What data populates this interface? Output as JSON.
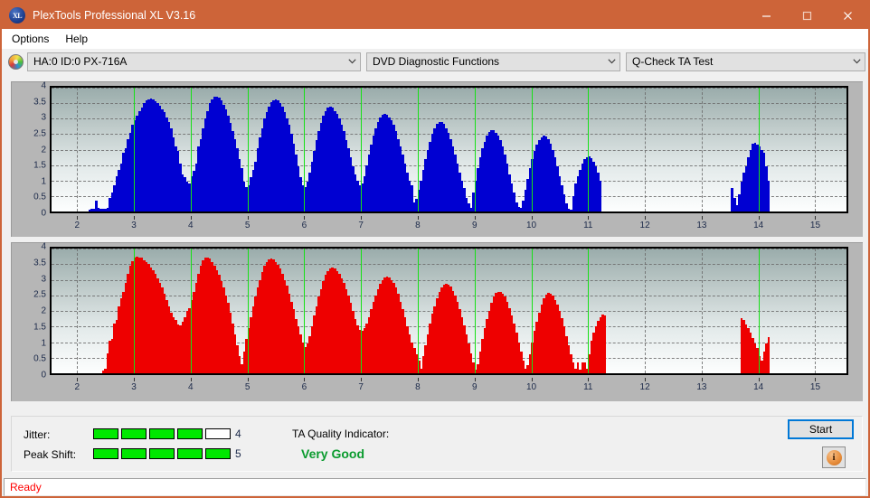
{
  "window": {
    "title": "PlexTools Professional XL V3.16",
    "app_icon": "xl-logo-icon",
    "minimize": "minimize-icon",
    "maximize": "maximize-icon",
    "close": "close-icon",
    "titlebar_color": "#cd6439"
  },
  "menu": {
    "items": [
      {
        "label": "Options"
      },
      {
        "label": "Help"
      }
    ]
  },
  "toolbar": {
    "drive_icon": "disc-icon",
    "drive_select": {
      "value": "HA:0 ID:0  PX-716A"
    },
    "function_select": {
      "value": "DVD Diagnostic Functions"
    },
    "test_select": {
      "value": "Q-Check TA Test"
    }
  },
  "results": {
    "jitter_label": "Jitter:",
    "jitter_value": "4",
    "jitter_segments": 5,
    "jitter_filled": 4,
    "peak_shift_label": "Peak Shift:",
    "peak_shift_value": "5",
    "peak_shift_segments": 5,
    "peak_shift_filled": 5,
    "ta_title": "TA Quality Indicator:",
    "ta_value": "Very Good",
    "ta_color": "#0a9b2e",
    "start_label": "Start",
    "info_icon": "info-icon",
    "info_glyph": "i"
  },
  "statusbar": {
    "text": "Ready"
  },
  "chart_data": [
    {
      "id": "ta-test-jitter",
      "type": "bar",
      "title": "",
      "xlabel": "",
      "ylabel": "",
      "color": "#0000d2",
      "bar_color": "#0000d2",
      "bg_top": "#9aacab",
      "bg_bottom": "#fdfefe",
      "xlim": [
        1.55,
        15.55
      ],
      "ylim": [
        0,
        4
      ],
      "yticks": [
        0,
        0.5,
        1,
        1.5,
        2,
        2.5,
        3,
        3.5,
        4
      ],
      "ytick_labels": [
        "0",
        "0.5",
        "1",
        "1.5",
        "2",
        "2.5",
        "3",
        "3.5",
        "4"
      ],
      "xticks": [
        2,
        3,
        4,
        5,
        6,
        7,
        8,
        9,
        10,
        11,
        12,
        13,
        14,
        15
      ],
      "xtick_labels": [
        "2",
        "3",
        "4",
        "5",
        "6",
        "7",
        "8",
        "9",
        "10",
        "11",
        "12",
        "13",
        "14",
        "15"
      ],
      "grid": true,
      "markers": [
        3,
        4,
        5,
        6,
        7,
        8,
        9,
        10,
        11,
        14
      ],
      "marker_color": "#17e017",
      "bar_width_x": 0.042,
      "x": [
        2.22,
        2.26,
        2.3,
        2.34,
        2.38,
        2.42,
        2.46,
        2.5,
        2.54,
        2.58,
        2.62,
        2.66,
        2.7,
        2.74,
        2.78,
        2.82,
        2.86,
        2.9,
        2.94,
        2.98,
        3.02,
        3.06,
        3.1,
        3.14,
        3.18,
        3.22,
        3.26,
        3.3,
        3.34,
        3.38,
        3.42,
        3.46,
        3.5,
        3.54,
        3.58,
        3.62,
        3.66,
        3.7,
        3.74,
        3.78,
        3.82,
        3.86,
        3.9,
        3.94,
        3.98,
        4.02,
        4.06,
        4.1,
        4.14,
        4.18,
        4.22,
        4.26,
        4.3,
        4.34,
        4.38,
        4.42,
        4.46,
        4.5,
        4.54,
        4.58,
        4.62,
        4.66,
        4.7,
        4.74,
        4.78,
        4.82,
        4.86,
        4.9,
        4.94,
        4.98,
        5.02,
        5.06,
        5.1,
        5.14,
        5.18,
        5.22,
        5.26,
        5.3,
        5.34,
        5.38,
        5.42,
        5.46,
        5.5,
        5.54,
        5.58,
        5.62,
        5.66,
        5.7,
        5.74,
        5.78,
        5.82,
        5.86,
        5.9,
        5.94,
        5.98,
        6.02,
        6.06,
        6.1,
        6.14,
        6.18,
        6.22,
        6.26,
        6.3,
        6.34,
        6.38,
        6.42,
        6.46,
        6.5,
        6.54,
        6.58,
        6.62,
        6.66,
        6.7,
        6.74,
        6.78,
        6.82,
        6.86,
        6.9,
        6.94,
        6.98,
        7.02,
        7.06,
        7.1,
        7.14,
        7.18,
        7.22,
        7.26,
        7.3,
        7.34,
        7.38,
        7.42,
        7.46,
        7.5,
        7.54,
        7.58,
        7.62,
        7.66,
        7.7,
        7.74,
        7.78,
        7.82,
        7.86,
        7.9,
        7.94,
        7.98,
        8.02,
        8.06,
        8.1,
        8.14,
        8.18,
        8.22,
        8.26,
        8.3,
        8.34,
        8.38,
        8.42,
        8.46,
        8.5,
        8.54,
        8.58,
        8.62,
        8.66,
        8.7,
        8.74,
        8.78,
        8.82,
        8.86,
        8.9,
        8.94,
        8.98,
        9.02,
        9.06,
        9.1,
        9.14,
        9.18,
        9.22,
        9.26,
        9.3,
        9.34,
        9.38,
        9.42,
        9.46,
        9.5,
        9.54,
        9.58,
        9.62,
        9.66,
        9.7,
        9.74,
        9.78,
        9.82,
        9.86,
        9.9,
        9.94,
        9.98,
        10.02,
        10.06,
        10.1,
        10.14,
        10.18,
        10.22,
        10.26,
        10.3,
        10.34,
        10.38,
        10.42,
        10.46,
        10.5,
        10.54,
        10.58,
        10.62,
        10.66,
        10.7,
        10.74,
        10.78,
        10.82,
        10.86,
        10.9,
        10.94,
        10.98,
        11.02,
        11.06,
        11.1,
        11.14,
        11.18,
        11.22,
        13.54,
        13.58,
        13.62,
        13.66,
        13.7,
        13.74,
        13.78,
        13.82,
        13.86,
        13.9,
        13.94,
        13.98,
        14.02,
        14.06,
        14.1,
        14.14,
        14.18
      ],
      "values": [
        0.05,
        0.08,
        0.1,
        0.36,
        0.12,
        0.1,
        0.1,
        0.1,
        0.12,
        0.45,
        0.62,
        0.85,
        1.15,
        1.35,
        1.55,
        1.9,
        2.05,
        2.35,
        2.55,
        2.8,
        2.95,
        3.1,
        3.25,
        3.35,
        3.5,
        3.58,
        3.62,
        3.65,
        3.62,
        3.55,
        3.5,
        3.42,
        3.3,
        3.2,
        3.05,
        2.9,
        2.7,
        2.4,
        2.1,
        1.95,
        1.55,
        1.2,
        1.1,
        0.95,
        0.9,
        1.15,
        1.3,
        1.55,
        2.1,
        2.35,
        2.7,
        3.0,
        3.25,
        3.5,
        3.62,
        3.7,
        3.72,
        3.68,
        3.6,
        3.45,
        3.3,
        3.1,
        2.85,
        2.6,
        2.35,
        2.05,
        1.7,
        1.4,
        0.95,
        0.8,
        0.85,
        1.1,
        1.35,
        1.6,
        2.05,
        2.4,
        2.7,
        3.0,
        3.2,
        3.4,
        3.52,
        3.6,
        3.63,
        3.6,
        3.5,
        3.4,
        3.2,
        3.0,
        2.8,
        2.5,
        2.2,
        1.85,
        1.45,
        1.1,
        0.85,
        0.8,
        0.95,
        1.25,
        1.6,
        1.95,
        2.3,
        2.6,
        2.85,
        3.1,
        3.25,
        3.35,
        3.38,
        3.35,
        3.25,
        3.15,
        3.0,
        2.8,
        2.6,
        2.3,
        2.05,
        1.75,
        1.45,
        1.2,
        1.0,
        0.85,
        0.9,
        1.15,
        1.5,
        1.85,
        2.15,
        2.45,
        2.7,
        2.9,
        3.05,
        3.12,
        3.15,
        3.12,
        3.05,
        2.95,
        2.8,
        2.6,
        2.35,
        2.1,
        1.85,
        1.55,
        1.25,
        1.0,
        0.85,
        0.3,
        0.4,
        0.7,
        1.0,
        1.35,
        1.7,
        2.0,
        2.25,
        2.5,
        2.7,
        2.82,
        2.88,
        2.88,
        2.82,
        2.7,
        2.55,
        2.35,
        2.1,
        1.85,
        1.55,
        1.25,
        1.0,
        0.75,
        0.45,
        0.25,
        0.12,
        0.6,
        1.0,
        1.4,
        1.75,
        2.05,
        2.25,
        2.45,
        2.58,
        2.62,
        2.62,
        2.55,
        2.45,
        2.3,
        2.1,
        1.85,
        1.55,
        1.2,
        0.9,
        0.6,
        0.3,
        0.15,
        0.12,
        0.35,
        0.7,
        1.05,
        1.4,
        1.7,
        1.95,
        2.15,
        2.3,
        2.4,
        2.45,
        2.42,
        2.35,
        2.2,
        2.0,
        1.75,
        1.45,
        1.15,
        0.85,
        0.55,
        0.25,
        0.1,
        0.05,
        0.5,
        0.9,
        1.15,
        1.35,
        1.55,
        1.68,
        1.75,
        1.78,
        1.72,
        1.62,
        1.45,
        1.25,
        1.0,
        0.75,
        0.45,
        0.2,
        0.55,
        0.95,
        1.25,
        1.45,
        1.75,
        2.0,
        2.18,
        2.22,
        2.15,
        2.1,
        2.0,
        1.9,
        1.45,
        1.0,
        0.6,
        0.25,
        0.1
      ]
    },
    {
      "id": "ta-test-peak-shift",
      "type": "bar",
      "title": "",
      "xlabel": "",
      "ylabel": "",
      "color": "#ee0000",
      "bar_color": "#ee0000",
      "bg_top": "#9aacab",
      "bg_bottom": "#fdfefe",
      "xlim": [
        1.55,
        15.55
      ],
      "ylim": [
        0,
        4
      ],
      "yticks": [
        0,
        0.5,
        1,
        1.5,
        2,
        2.5,
        3,
        3.5,
        4
      ],
      "ytick_labels": [
        "0",
        "0.5",
        "1",
        "1.5",
        "2",
        "2.5",
        "3",
        "3.5",
        "4"
      ],
      "xticks": [
        2,
        3,
        4,
        5,
        6,
        7,
        8,
        9,
        10,
        11,
        12,
        13,
        14,
        15
      ],
      "xtick_labels": [
        "2",
        "3",
        "4",
        "5",
        "6",
        "7",
        "8",
        "9",
        "10",
        "11",
        "12",
        "13",
        "14",
        "15"
      ],
      "grid": true,
      "markers": [
        3,
        4,
        5,
        6,
        7,
        8,
        9,
        10,
        11,
        14
      ],
      "marker_color": "#17e017",
      "bar_width_x": 0.042,
      "x": [
        2.46,
        2.5,
        2.54,
        2.58,
        2.62,
        2.66,
        2.7,
        2.74,
        2.78,
        2.82,
        2.86,
        2.9,
        2.94,
        2.98,
        3.02,
        3.06,
        3.1,
        3.14,
        3.18,
        3.22,
        3.26,
        3.3,
        3.34,
        3.38,
        3.42,
        3.46,
        3.5,
        3.54,
        3.58,
        3.62,
        3.66,
        3.7,
        3.74,
        3.78,
        3.82,
        3.86,
        3.9,
        3.94,
        3.98,
        4.02,
        4.06,
        4.1,
        4.14,
        4.18,
        4.22,
        4.26,
        4.3,
        4.34,
        4.38,
        4.42,
        4.46,
        4.5,
        4.54,
        4.58,
        4.62,
        4.66,
        4.7,
        4.74,
        4.78,
        4.82,
        4.86,
        4.9,
        4.94,
        4.98,
        5.02,
        5.06,
        5.1,
        5.14,
        5.18,
        5.22,
        5.26,
        5.3,
        5.34,
        5.38,
        5.42,
        5.46,
        5.5,
        5.54,
        5.58,
        5.62,
        5.66,
        5.7,
        5.74,
        5.78,
        5.82,
        5.86,
        5.9,
        5.94,
        5.98,
        6.02,
        6.06,
        6.1,
        6.14,
        6.18,
        6.22,
        6.26,
        6.3,
        6.34,
        6.38,
        6.42,
        6.46,
        6.5,
        6.54,
        6.58,
        6.62,
        6.66,
        6.7,
        6.74,
        6.78,
        6.82,
        6.86,
        6.9,
        6.94,
        6.98,
        7.02,
        7.06,
        7.1,
        7.14,
        7.18,
        7.22,
        7.26,
        7.3,
        7.34,
        7.38,
        7.42,
        7.46,
        7.5,
        7.54,
        7.58,
        7.62,
        7.66,
        7.7,
        7.74,
        7.78,
        7.82,
        7.86,
        7.9,
        7.94,
        7.98,
        8.02,
        8.06,
        8.1,
        8.14,
        8.18,
        8.22,
        8.26,
        8.3,
        8.34,
        8.38,
        8.42,
        8.46,
        8.5,
        8.54,
        8.58,
        8.62,
        8.66,
        8.7,
        8.74,
        8.78,
        8.82,
        8.86,
        8.9,
        8.94,
        8.98,
        9.02,
        9.06,
        9.1,
        9.14,
        9.18,
        9.22,
        9.26,
        9.3,
        9.34,
        9.38,
        9.42,
        9.46,
        9.5,
        9.54,
        9.58,
        9.62,
        9.66,
        9.7,
        9.74,
        9.78,
        9.82,
        9.86,
        9.9,
        9.94,
        9.98,
        10.02,
        10.06,
        10.1,
        10.14,
        10.18,
        10.22,
        10.26,
        10.3,
        10.34,
        10.38,
        10.42,
        10.46,
        10.5,
        10.54,
        10.58,
        10.62,
        10.66,
        10.7,
        10.74,
        10.78,
        10.82,
        10.86,
        10.9,
        10.94,
        10.98,
        11.02,
        11.06,
        11.1,
        11.14,
        11.18,
        11.22,
        11.26,
        11.3,
        13.7,
        13.74,
        13.78,
        13.82,
        13.86,
        13.9,
        13.94,
        13.98,
        14.02,
        14.06,
        14.1,
        14.14,
        14.18
      ],
      "values": [
        0.1,
        0.15,
        0.65,
        1.05,
        1.1,
        1.6,
        1.7,
        2.15,
        2.4,
        2.6,
        2.9,
        3.2,
        3.45,
        3.6,
        3.72,
        3.75,
        3.72,
        3.7,
        3.62,
        3.58,
        3.5,
        3.4,
        3.3,
        3.2,
        3.05,
        2.9,
        2.75,
        2.55,
        2.35,
        2.15,
        1.95,
        1.8,
        1.7,
        1.58,
        1.55,
        1.65,
        1.8,
        2.0,
        2.1,
        2.35,
        2.6,
        2.9,
        3.2,
        3.45,
        3.62,
        3.7,
        3.72,
        3.68,
        3.58,
        3.45,
        3.3,
        3.15,
        2.95,
        2.75,
        2.5,
        2.25,
        1.95,
        1.6,
        1.25,
        0.9,
        0.55,
        0.3,
        0.7,
        1.1,
        1.45,
        1.8,
        2.15,
        2.45,
        2.75,
        3.0,
        3.25,
        3.45,
        3.58,
        3.66,
        3.68,
        3.66,
        3.58,
        3.48,
        3.35,
        3.2,
        3.0,
        2.8,
        2.55,
        2.3,
        2.05,
        1.75,
        1.5,
        1.25,
        1.0,
        0.85,
        0.95,
        1.2,
        1.5,
        1.85,
        2.15,
        2.45,
        2.7,
        2.95,
        3.15,
        3.28,
        3.35,
        3.38,
        3.35,
        3.28,
        3.18,
        3.05,
        2.9,
        2.7,
        2.5,
        2.25,
        2.0,
        1.75,
        1.55,
        1.4,
        1.35,
        1.45,
        1.6,
        1.8,
        2.05,
        2.3,
        2.5,
        2.7,
        2.88,
        3.0,
        3.08,
        3.1,
        3.08,
        3.0,
        2.9,
        2.75,
        2.55,
        2.3,
        2.05,
        1.8,
        1.5,
        1.25,
        1.0,
        0.8,
        0.6,
        0.4,
        0.15,
        0.55,
        0.9,
        1.25,
        1.6,
        1.9,
        2.15,
        2.4,
        2.6,
        2.75,
        2.85,
        2.88,
        2.85,
        2.78,
        2.65,
        2.5,
        2.3,
        2.05,
        1.8,
        1.55,
        1.25,
        0.95,
        0.65,
        0.35,
        0.12,
        0.3,
        0.7,
        1.1,
        1.45,
        1.75,
        2.0,
        2.25,
        2.45,
        2.58,
        2.62,
        2.6,
        2.55,
        2.45,
        2.3,
        2.1,
        1.85,
        1.6,
        1.3,
        1.0,
        0.7,
        0.4,
        0.15,
        0.25,
        0.6,
        1.0,
        1.35,
        1.65,
        1.95,
        2.2,
        2.4,
        2.52,
        2.58,
        2.55,
        2.48,
        2.35,
        2.2,
        2.0,
        1.78,
        1.5,
        1.2,
        0.9,
        0.6,
        0.35,
        0.15,
        0.35,
        0.12,
        0.35,
        0.35,
        0.15,
        0.6,
        1.05,
        1.3,
        1.5,
        1.68,
        1.8,
        1.88,
        1.85,
        1.78,
        1.7,
        1.58,
        1.45,
        1.3,
        1.12,
        0.95,
        0.8,
        0.55,
        0.4,
        0.7,
        0.95,
        1.15,
        1.28,
        1.2,
        1.15,
        1.05,
        1.0,
        0.8,
        0.55,
        0.25,
        0.3,
        0.12
      ]
    }
  ]
}
